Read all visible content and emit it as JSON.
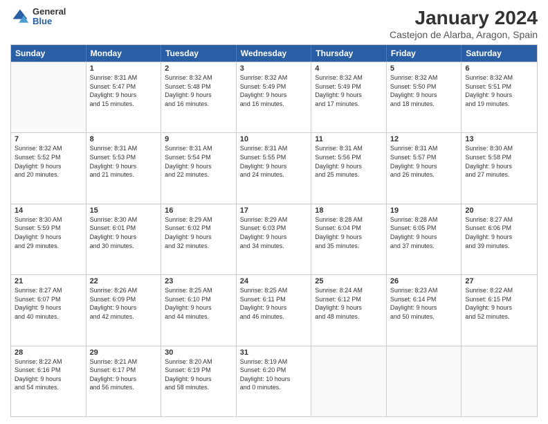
{
  "logo": {
    "general": "General",
    "blue": "Blue"
  },
  "title": "January 2024",
  "subtitle": "Castejon de Alarba, Aragon, Spain",
  "headers": [
    "Sunday",
    "Monday",
    "Tuesday",
    "Wednesday",
    "Thursday",
    "Friday",
    "Saturday"
  ],
  "weeks": [
    [
      {
        "day": "",
        "content": ""
      },
      {
        "day": "1",
        "content": "Sunrise: 8:31 AM\nSunset: 5:47 PM\nDaylight: 9 hours\nand 15 minutes."
      },
      {
        "day": "2",
        "content": "Sunrise: 8:32 AM\nSunset: 5:48 PM\nDaylight: 9 hours\nand 16 minutes."
      },
      {
        "day": "3",
        "content": "Sunrise: 8:32 AM\nSunset: 5:49 PM\nDaylight: 9 hours\nand 16 minutes."
      },
      {
        "day": "4",
        "content": "Sunrise: 8:32 AM\nSunset: 5:49 PM\nDaylight: 9 hours\nand 17 minutes."
      },
      {
        "day": "5",
        "content": "Sunrise: 8:32 AM\nSunset: 5:50 PM\nDaylight: 9 hours\nand 18 minutes."
      },
      {
        "day": "6",
        "content": "Sunrise: 8:32 AM\nSunset: 5:51 PM\nDaylight: 9 hours\nand 19 minutes."
      }
    ],
    [
      {
        "day": "7",
        "content": "Sunrise: 8:32 AM\nSunset: 5:52 PM\nDaylight: 9 hours\nand 20 minutes."
      },
      {
        "day": "8",
        "content": "Sunrise: 8:31 AM\nSunset: 5:53 PM\nDaylight: 9 hours\nand 21 minutes."
      },
      {
        "day": "9",
        "content": "Sunrise: 8:31 AM\nSunset: 5:54 PM\nDaylight: 9 hours\nand 22 minutes."
      },
      {
        "day": "10",
        "content": "Sunrise: 8:31 AM\nSunset: 5:55 PM\nDaylight: 9 hours\nand 24 minutes."
      },
      {
        "day": "11",
        "content": "Sunrise: 8:31 AM\nSunset: 5:56 PM\nDaylight: 9 hours\nand 25 minutes."
      },
      {
        "day": "12",
        "content": "Sunrise: 8:31 AM\nSunset: 5:57 PM\nDaylight: 9 hours\nand 26 minutes."
      },
      {
        "day": "13",
        "content": "Sunrise: 8:30 AM\nSunset: 5:58 PM\nDaylight: 9 hours\nand 27 minutes."
      }
    ],
    [
      {
        "day": "14",
        "content": "Sunrise: 8:30 AM\nSunset: 5:59 PM\nDaylight: 9 hours\nand 29 minutes."
      },
      {
        "day": "15",
        "content": "Sunrise: 8:30 AM\nSunset: 6:01 PM\nDaylight: 9 hours\nand 30 minutes."
      },
      {
        "day": "16",
        "content": "Sunrise: 8:29 AM\nSunset: 6:02 PM\nDaylight: 9 hours\nand 32 minutes."
      },
      {
        "day": "17",
        "content": "Sunrise: 8:29 AM\nSunset: 6:03 PM\nDaylight: 9 hours\nand 34 minutes."
      },
      {
        "day": "18",
        "content": "Sunrise: 8:28 AM\nSunset: 6:04 PM\nDaylight: 9 hours\nand 35 minutes."
      },
      {
        "day": "19",
        "content": "Sunrise: 8:28 AM\nSunset: 6:05 PM\nDaylight: 9 hours\nand 37 minutes."
      },
      {
        "day": "20",
        "content": "Sunrise: 8:27 AM\nSunset: 6:06 PM\nDaylight: 9 hours\nand 39 minutes."
      }
    ],
    [
      {
        "day": "21",
        "content": "Sunrise: 8:27 AM\nSunset: 6:07 PM\nDaylight: 9 hours\nand 40 minutes."
      },
      {
        "day": "22",
        "content": "Sunrise: 8:26 AM\nSunset: 6:09 PM\nDaylight: 9 hours\nand 42 minutes."
      },
      {
        "day": "23",
        "content": "Sunrise: 8:25 AM\nSunset: 6:10 PM\nDaylight: 9 hours\nand 44 minutes."
      },
      {
        "day": "24",
        "content": "Sunrise: 8:25 AM\nSunset: 6:11 PM\nDaylight: 9 hours\nand 46 minutes."
      },
      {
        "day": "25",
        "content": "Sunrise: 8:24 AM\nSunset: 6:12 PM\nDaylight: 9 hours\nand 48 minutes."
      },
      {
        "day": "26",
        "content": "Sunrise: 8:23 AM\nSunset: 6:14 PM\nDaylight: 9 hours\nand 50 minutes."
      },
      {
        "day": "27",
        "content": "Sunrise: 8:22 AM\nSunset: 6:15 PM\nDaylight: 9 hours\nand 52 minutes."
      }
    ],
    [
      {
        "day": "28",
        "content": "Sunrise: 8:22 AM\nSunset: 6:16 PM\nDaylight: 9 hours\nand 54 minutes."
      },
      {
        "day": "29",
        "content": "Sunrise: 8:21 AM\nSunset: 6:17 PM\nDaylight: 9 hours\nand 56 minutes."
      },
      {
        "day": "30",
        "content": "Sunrise: 8:20 AM\nSunset: 6:19 PM\nDaylight: 9 hours\nand 58 minutes."
      },
      {
        "day": "31",
        "content": "Sunrise: 8:19 AM\nSunset: 6:20 PM\nDaylight: 10 hours\nand 0 minutes."
      },
      {
        "day": "",
        "content": ""
      },
      {
        "day": "",
        "content": ""
      },
      {
        "day": "",
        "content": ""
      }
    ]
  ]
}
